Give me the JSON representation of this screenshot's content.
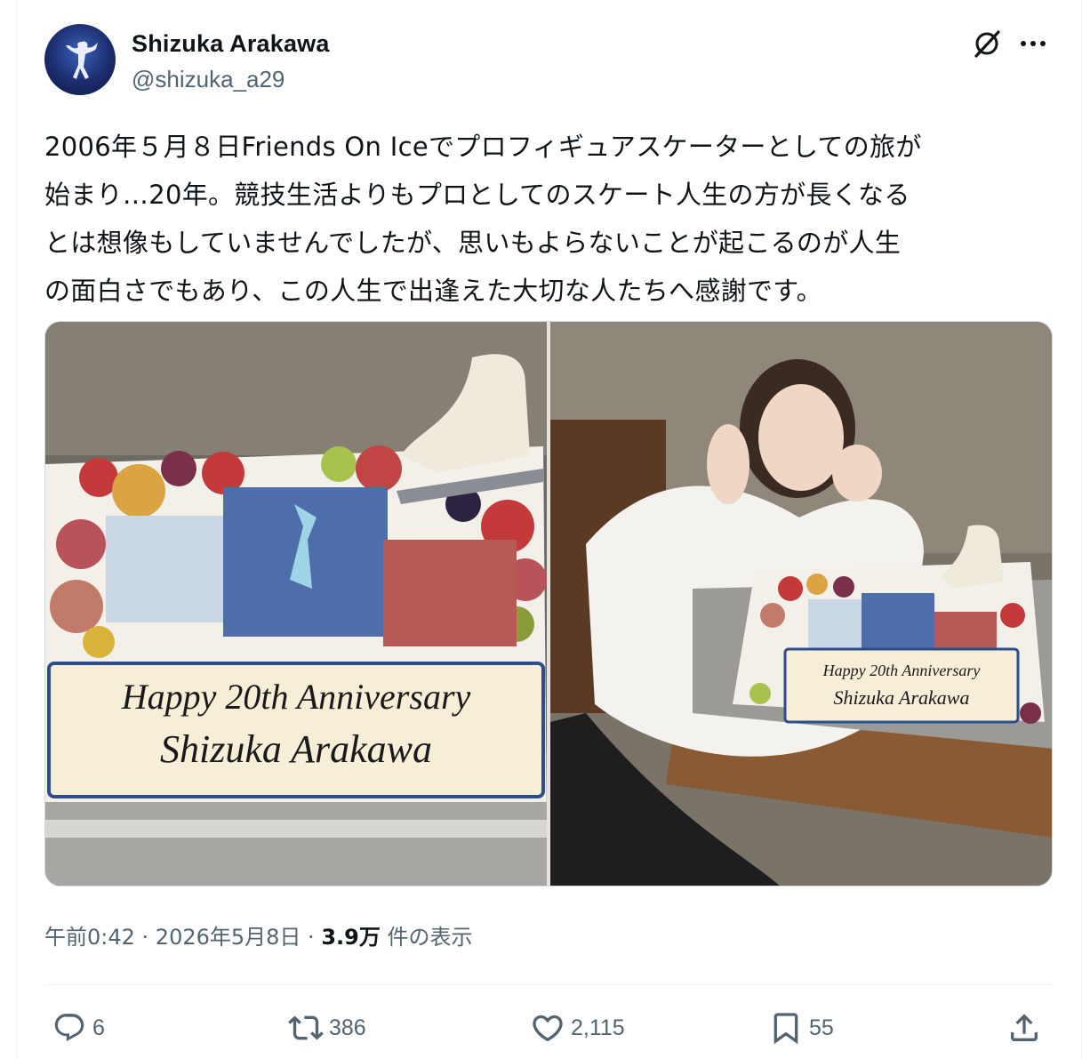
{
  "author": {
    "name": "Shizuka Arakawa",
    "handle": "@shizuka_a29"
  },
  "tweet": {
    "text": "2006年５月８日Friends On Iceでプロフィギュアスケーターとしての旅が\n始まり…20年。競技生活よりもプロとしてのスケート人生の方が長くなる\nとは想像もしていませんでしたが、思いもよらないことが起こるのが人生\nの面白さでもあり、この人生で出逢えた大切な人たちへ感謝です。"
  },
  "media": {
    "left_cake": {
      "line1": "Happy 20th Anniversary",
      "line2": "Shizuka Arakawa"
    },
    "right_cake": {
      "line1": "Happy 20th Anniversary",
      "line2": "Shizuka Arakawa"
    }
  },
  "meta": {
    "time": "午前0:42",
    "sep1": " · ",
    "date": "2026年5月8日",
    "sep2": " · ",
    "views": "3.9万",
    "views_label": " 件の表示"
  },
  "actions": {
    "replies": "6",
    "reposts": "386",
    "likes": "2,115",
    "bookmarks": "55"
  },
  "icons": {
    "grok": "grok-icon",
    "more": "more-icon",
    "reply": "reply-icon",
    "retweet": "retweet-icon",
    "like": "heart-icon",
    "bookmark": "bookmark-icon",
    "share": "share-icon"
  },
  "colors": {
    "text": "#0f1419",
    "secondary": "#536471",
    "border": "#cfd9de"
  }
}
